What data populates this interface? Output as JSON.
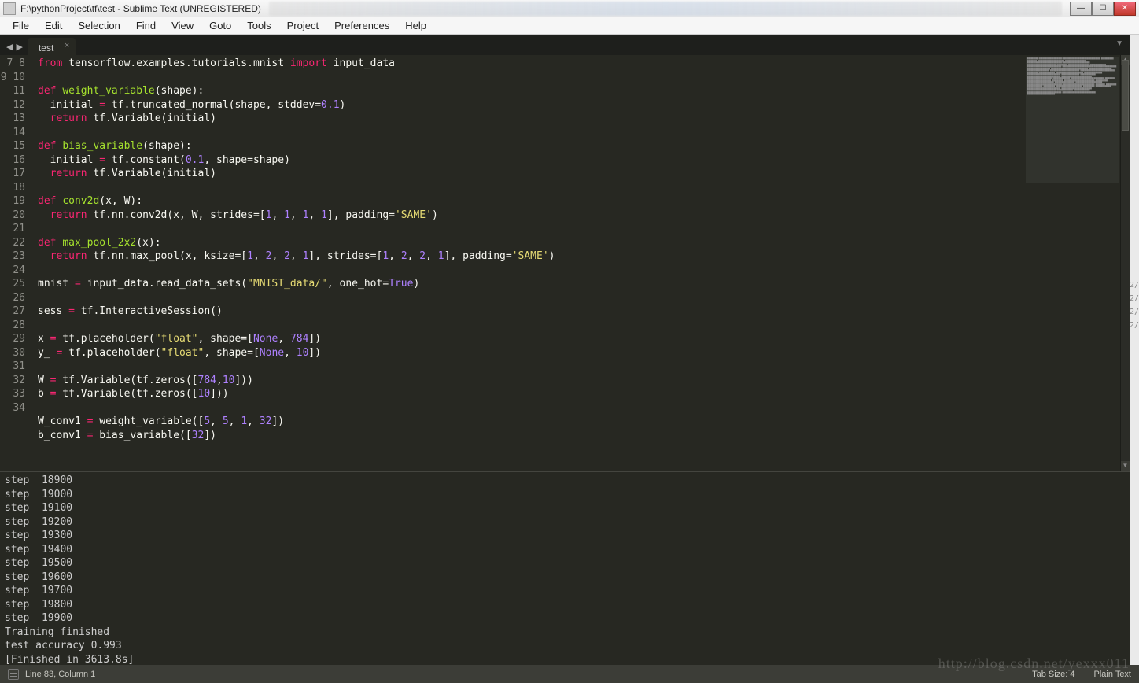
{
  "window": {
    "title": "F:\\pythonProject\\tf\\test - Sublime Text (UNREGISTERED)"
  },
  "menubar": [
    "File",
    "Edit",
    "Selection",
    "Find",
    "View",
    "Goto",
    "Tools",
    "Project",
    "Preferences",
    "Help"
  ],
  "tab": {
    "name": "test"
  },
  "gutter_start": 7,
  "gutter_end": 34,
  "code_lines": [
    {
      "t": "from",
      "c": "kw",
      "rest": [
        [
          " tensorflow.examples.tutorials.mnist ",
          "plain"
        ],
        [
          "import",
          "kw"
        ],
        [
          " input_data",
          "plain"
        ]
      ]
    },
    {
      "raw": ""
    },
    {
      "t": "def",
      "c": "kw",
      "rest": [
        [
          " ",
          "plain"
        ],
        [
          "weight_variable",
          "fn"
        ],
        [
          "(shape):",
          "plain"
        ]
      ]
    },
    {
      "raw": "  initial = tf.truncated_normal(shape, stddev=0.1)",
      "nums": [
        "0.1"
      ],
      "ops": [
        "="
      ]
    },
    {
      "t": "  return",
      "c": "kw",
      "rest": [
        [
          " tf.Variable(initial)",
          "plain"
        ]
      ]
    },
    {
      "raw": ""
    },
    {
      "t": "def",
      "c": "kw",
      "rest": [
        [
          " ",
          "plain"
        ],
        [
          "bias_variable",
          "fn"
        ],
        [
          "(shape):",
          "plain"
        ]
      ]
    },
    {
      "raw": "  initial = tf.constant(0.1, shape=shape)",
      "nums": [
        "0.1"
      ],
      "ops": [
        "="
      ]
    },
    {
      "t": "  return",
      "c": "kw",
      "rest": [
        [
          " tf.Variable(initial)",
          "plain"
        ]
      ]
    },
    {
      "raw": ""
    },
    {
      "t": "def",
      "c": "kw",
      "rest": [
        [
          " ",
          "plain"
        ],
        [
          "conv2d",
          "fn"
        ],
        [
          "(x, W):",
          "plain"
        ]
      ]
    },
    {
      "t": "  return",
      "c": "kw",
      "rest": [
        [
          " tf.nn.conv2d(x, W, strides=[",
          "plain"
        ],
        [
          "1",
          "num"
        ],
        [
          ", ",
          "plain"
        ],
        [
          "1",
          "num"
        ],
        [
          ", ",
          "plain"
        ],
        [
          "1",
          "num"
        ],
        [
          ", ",
          "plain"
        ],
        [
          "1",
          "num"
        ],
        [
          "], padding=",
          "plain"
        ],
        [
          "'SAME'",
          "str"
        ],
        [
          ")",
          "plain"
        ]
      ]
    },
    {
      "raw": ""
    },
    {
      "t": "def",
      "c": "kw",
      "rest": [
        [
          " ",
          "plain"
        ],
        [
          "max_pool_2x2",
          "fn"
        ],
        [
          "(x):",
          "plain"
        ]
      ]
    },
    {
      "t": "  return",
      "c": "kw",
      "rest": [
        [
          " tf.nn.max_pool(x, ksize=[",
          "plain"
        ],
        [
          "1",
          "num"
        ],
        [
          ", ",
          "plain"
        ],
        [
          "2",
          "num"
        ],
        [
          ", ",
          "plain"
        ],
        [
          "2",
          "num"
        ],
        [
          ", ",
          "plain"
        ],
        [
          "1",
          "num"
        ],
        [
          "], strides=[",
          "plain"
        ],
        [
          "1",
          "num"
        ],
        [
          ", ",
          "plain"
        ],
        [
          "2",
          "num"
        ],
        [
          ", ",
          "plain"
        ],
        [
          "2",
          "num"
        ],
        [
          ", ",
          "plain"
        ],
        [
          "1",
          "num"
        ],
        [
          "], padding=",
          "plain"
        ],
        [
          "'SAME'",
          "str"
        ],
        [
          ")",
          "plain"
        ]
      ]
    },
    {
      "raw": ""
    },
    {
      "rest": [
        [
          "mnist ",
          "plain"
        ],
        [
          "=",
          "op"
        ],
        [
          " input_data.read_data_sets(",
          "plain"
        ],
        [
          "\"MNIST_data/\"",
          "str"
        ],
        [
          ", one_hot=",
          "plain"
        ],
        [
          "True",
          "num"
        ],
        [
          ")",
          "plain"
        ]
      ]
    },
    {
      "raw": ""
    },
    {
      "rest": [
        [
          "sess ",
          "plain"
        ],
        [
          "=",
          "op"
        ],
        [
          " tf.InteractiveSession()",
          "plain"
        ]
      ]
    },
    {
      "raw": ""
    },
    {
      "rest": [
        [
          "x ",
          "plain"
        ],
        [
          "=",
          "op"
        ],
        [
          " tf.placeholder(",
          "plain"
        ],
        [
          "\"float\"",
          "str"
        ],
        [
          ", shape=[",
          "plain"
        ],
        [
          "None",
          "num"
        ],
        [
          ", ",
          "plain"
        ],
        [
          "784",
          "num"
        ],
        [
          "])",
          "plain"
        ]
      ]
    },
    {
      "rest": [
        [
          "y_ ",
          "plain"
        ],
        [
          "=",
          "op"
        ],
        [
          " tf.placeholder(",
          "plain"
        ],
        [
          "\"float\"",
          "str"
        ],
        [
          ", shape=[",
          "plain"
        ],
        [
          "None",
          "num"
        ],
        [
          ", ",
          "plain"
        ],
        [
          "10",
          "num"
        ],
        [
          "])",
          "plain"
        ]
      ]
    },
    {
      "raw": ""
    },
    {
      "rest": [
        [
          "W ",
          "plain"
        ],
        [
          "=",
          "op"
        ],
        [
          " tf.Variable(tf.zeros([",
          "plain"
        ],
        [
          "784",
          "num"
        ],
        [
          ",",
          "plain"
        ],
        [
          "10",
          "num"
        ],
        [
          "]))",
          "plain"
        ]
      ]
    },
    {
      "rest": [
        [
          "b ",
          "plain"
        ],
        [
          "=",
          "op"
        ],
        [
          " tf.Variable(tf.zeros([",
          "plain"
        ],
        [
          "10",
          "num"
        ],
        [
          "]))",
          "plain"
        ]
      ]
    },
    {
      "raw": ""
    },
    {
      "rest": [
        [
          "W_conv1 ",
          "plain"
        ],
        [
          "=",
          "op"
        ],
        [
          " weight_variable([",
          "plain"
        ],
        [
          "5",
          "num"
        ],
        [
          ", ",
          "plain"
        ],
        [
          "5",
          "num"
        ],
        [
          ", ",
          "plain"
        ],
        [
          "1",
          "num"
        ],
        [
          ", ",
          "plain"
        ],
        [
          "32",
          "num"
        ],
        [
          "])",
          "plain"
        ]
      ]
    },
    {
      "rest": [
        [
          "b_conv1 ",
          "plain"
        ],
        [
          "=",
          "op"
        ],
        [
          " bias_variable([",
          "plain"
        ],
        [
          "32",
          "num"
        ],
        [
          "])",
          "plain"
        ]
      ]
    }
  ],
  "console_lines": [
    "step  18900",
    "step  19000",
    "step  19100",
    "step  19200",
    "step  19300",
    "step  19400",
    "step  19500",
    "step  19600",
    "step  19700",
    "step  19800",
    "step  19900",
    "Training finished",
    "test accuracy 0.993",
    "[Finished in 3613.8s]"
  ],
  "status": {
    "linecol": "Line 83, Column 1",
    "tabsize": "Tab Size: 4",
    "syntax": "Plain Text"
  },
  "watermark": "http://blog.csdn.net/yexxx011",
  "side_dates": [
    "2/",
    "2/",
    "2/",
    "2/"
  ]
}
